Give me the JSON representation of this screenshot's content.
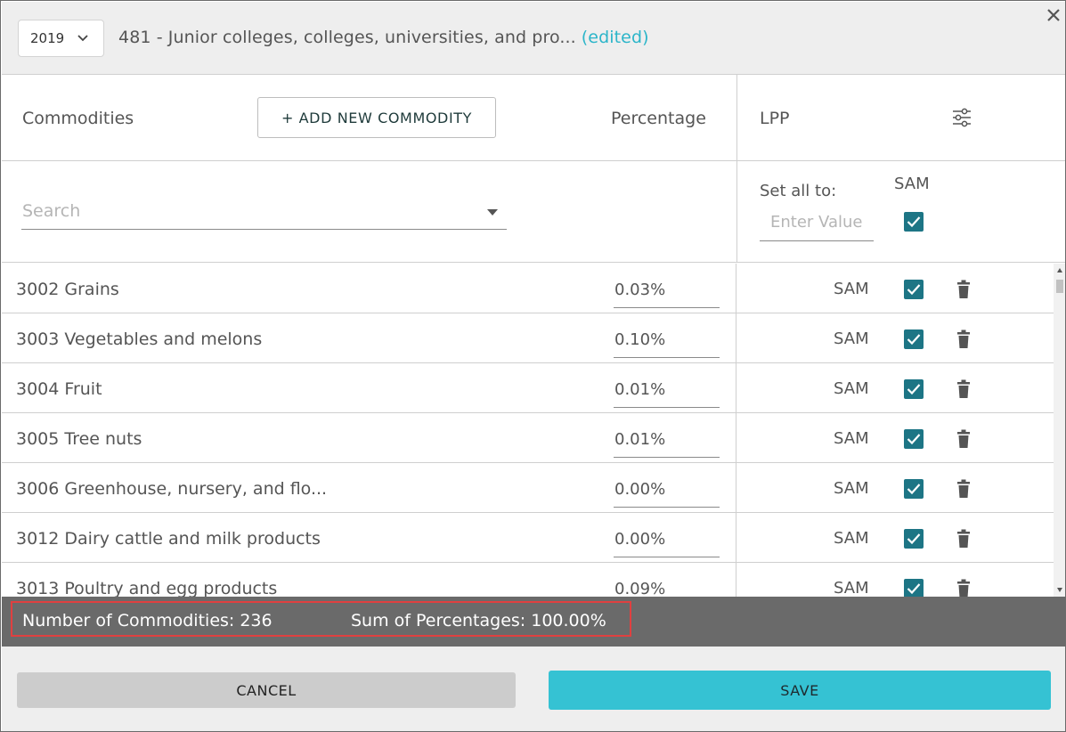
{
  "header": {
    "year": "2019",
    "title": "481 - Junior colleges, colleges, universities, and pro...",
    "edited_label": "(edited)"
  },
  "columns": {
    "commodities": "Commodities",
    "add_button": "+ ADD NEW COMMODITY",
    "percentage": "Percentage",
    "lpp": "LPP"
  },
  "search": {
    "placeholder": "Search"
  },
  "set_all": {
    "label": "Set all to:",
    "placeholder": "Enter Value",
    "sam_label": "SAM",
    "sam_checked": true
  },
  "rows": [
    {
      "name": "3002 Grains",
      "percentage": "0.03%",
      "lpp": "SAM",
      "checked": true
    },
    {
      "name": "3003 Vegetables and melons",
      "percentage": "0.10%",
      "lpp": "SAM",
      "checked": true
    },
    {
      "name": "3004 Fruit",
      "percentage": "0.01%",
      "lpp": "SAM",
      "checked": true
    },
    {
      "name": "3005 Tree nuts",
      "percentage": "0.01%",
      "lpp": "SAM",
      "checked": true
    },
    {
      "name": "3006 Greenhouse, nursery, and flo...",
      "percentage": "0.00%",
      "lpp": "SAM",
      "checked": true
    },
    {
      "name": "3012 Dairy cattle and milk products",
      "percentage": "0.00%",
      "lpp": "SAM",
      "checked": true
    },
    {
      "name": "3013 Poultry and egg products",
      "percentage": "0.09%",
      "lpp": "SAM",
      "checked": true
    }
  ],
  "stats": {
    "count": "Number of Commodities: 236",
    "sum": "Sum of Percentages: 100.00%"
  },
  "actions": {
    "cancel": "CANCEL",
    "save": "SAVE"
  },
  "colors": {
    "accent": "#35c2d3",
    "checkbox": "#1d7585",
    "edited": "#2bb5c9",
    "highlight": "#e04040"
  }
}
